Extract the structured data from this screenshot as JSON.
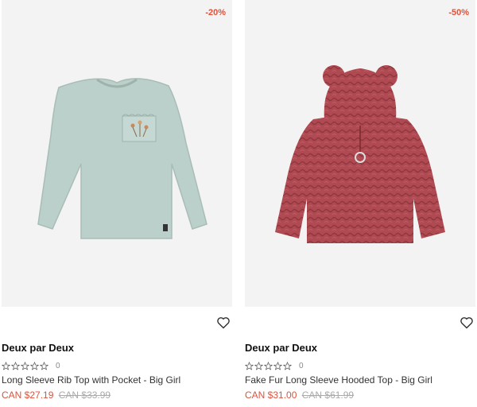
{
  "products": [
    {
      "badge": "-20%",
      "brand": "Deux par Deux",
      "rating_count": "0",
      "title": "Long Sleeve Rib Top with Pocket - Big Girl",
      "sale_price": "CAN $27.19",
      "original_price": "CAN $33.99",
      "image": "mint-long-sleeve-top",
      "garment_color": "#bcd0cb"
    },
    {
      "badge": "-50%",
      "brand": "Deux par Deux",
      "rating_count": "0",
      "title": "Fake Fur Long Sleeve Hooded Top - Big Girl",
      "sale_price": "CAN $31.00",
      "original_price": "CAN $61.99",
      "image": "red-fur-hooded-top",
      "garment_color": "#b04a52"
    }
  ],
  "colors": {
    "accent": "#e0523a",
    "image_bg": "#f3f3f3"
  }
}
